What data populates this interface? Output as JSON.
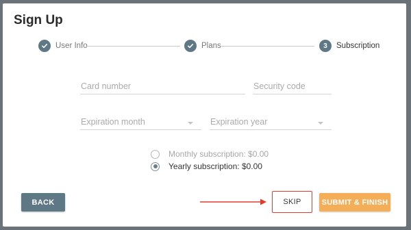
{
  "dialog": {
    "title": "Sign Up"
  },
  "stepper": {
    "steps": [
      {
        "label": "User Info",
        "state": "complete",
        "icon": "check-icon"
      },
      {
        "label": "Plans",
        "state": "complete",
        "icon": "check-icon"
      },
      {
        "label": "Subscription",
        "state": "active",
        "number": "3"
      }
    ]
  },
  "form": {
    "card_number_placeholder": "Card number",
    "security_code_placeholder": "Security code",
    "expiration_month_placeholder": "Expiration month",
    "expiration_year_placeholder": "Expiration year",
    "options": [
      {
        "label": "Monthly subscription: $0.00",
        "checked": false
      },
      {
        "label": "Yearly subscription: $0.00",
        "checked": true
      }
    ]
  },
  "buttons": {
    "back": "BACK",
    "skip": "SKIP",
    "submit": "SUBMIT & FINISH"
  },
  "colors": {
    "primary": "#5e7885",
    "accent": "#f4ae58",
    "highlight": "#e23b2c"
  }
}
